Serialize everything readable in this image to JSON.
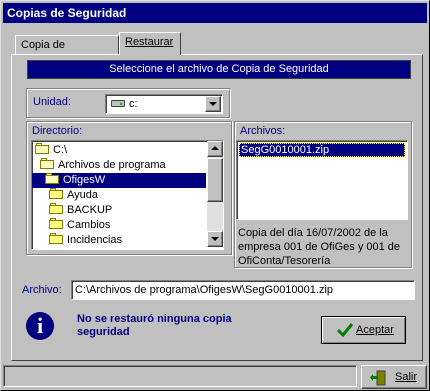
{
  "window": {
    "title": "Copias de Seguridad"
  },
  "tabs": [
    {
      "label": "Copia de Seguridad",
      "active": false
    },
    {
      "label": "Restaurar",
      "active": true
    }
  ],
  "banner": "Seleccione el archivo de Copia de Seguridad",
  "unidad": {
    "label": "Unidad:",
    "value": "c:",
    "icon": "hard-drive-icon"
  },
  "directorio": {
    "label": "Directorio:",
    "items": [
      {
        "label": "C:\\",
        "level": 0,
        "selected": false
      },
      {
        "label": "Archivos de programa",
        "level": 1,
        "selected": false
      },
      {
        "label": "OfigesW",
        "level": 2,
        "selected": true
      },
      {
        "label": "Ayuda",
        "level": 3,
        "selected": false
      },
      {
        "label": "BACKUP",
        "level": 3,
        "selected": false
      },
      {
        "label": "Cambios",
        "level": 3,
        "selected": false
      },
      {
        "label": "Incidencias",
        "level": 3,
        "selected": false
      }
    ]
  },
  "archivos": {
    "label": "Archivos:",
    "items": [
      {
        "label": "SegG0010001.zip",
        "selected": true
      }
    ],
    "description": "Copia del día 16/07/2002 de la empresa 001 de OfiGes y 001 de OfiConta/Tesorería"
  },
  "archivo": {
    "label": "Archivo:",
    "value": "C:\\Archivos de programa\\OfigesW\\SegG0010001.zip"
  },
  "status": {
    "message": "No se restauró ninguna copia seguridad",
    "icon": "info-icon"
  },
  "buttons": {
    "aceptar": "Aceptar",
    "salir": "Salir"
  },
  "colors": {
    "title_bar": "#000080",
    "face": "#c0c0c0",
    "selection": "#000080",
    "label_text": "#000080",
    "check": "#008000"
  }
}
